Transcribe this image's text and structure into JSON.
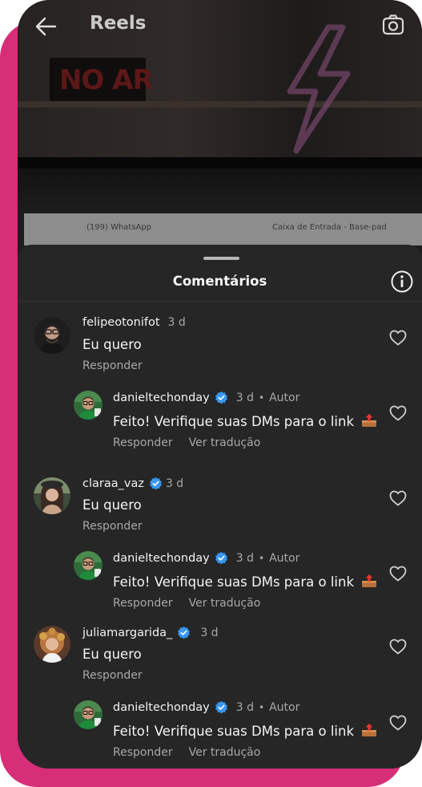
{
  "header": {
    "title": "Reels"
  },
  "video": {
    "sign_text": "NO AR",
    "tabs": [
      {
        "label": "(199) WhatsApp"
      },
      {
        "label": "Caixa de Entrada - Base-pad"
      }
    ]
  },
  "sheet": {
    "title": "Comentários"
  },
  "comments": [
    {
      "user": "felipeotonifot",
      "time": "3 d",
      "verified": false,
      "text": "Eu quero",
      "actions": [
        "Responder"
      ]
    },
    {
      "user": "danieltechonday",
      "time": "3 d",
      "verified": true,
      "author": "Autor",
      "text": "Feito! Verifique suas DMs para o link",
      "emoji": "outbox-tray-icon",
      "actions": [
        "Responder",
        "Ver tradução"
      ]
    },
    {
      "user": "claraa_vaz",
      "time": "3 d",
      "verified": true,
      "text": "Eu quero",
      "actions": [
        "Responder"
      ]
    },
    {
      "user": "danieltechonday",
      "time": "3 d",
      "verified": true,
      "author": "Autor",
      "text": "Feito! Verifique suas DMs para o link",
      "emoji": "outbox-tray-icon",
      "actions": [
        "Responder",
        "Ver tradução"
      ]
    },
    {
      "user": "juliamargarida_",
      "time": "3 d",
      "verified": true,
      "text": "Eu quero",
      "actions": [
        "Responder"
      ]
    },
    {
      "user": "danieltechonday",
      "time": "3 d",
      "verified": true,
      "author": "Autor",
      "text": "Feito! Verifique suas DMs para o link",
      "emoji": "outbox-tray-icon",
      "actions": [
        "Responder",
        "Ver tradução"
      ]
    }
  ],
  "colors": {
    "frame_accent": "#d62e77",
    "sheet_bg": "#262626",
    "verified": "#3897f0"
  }
}
